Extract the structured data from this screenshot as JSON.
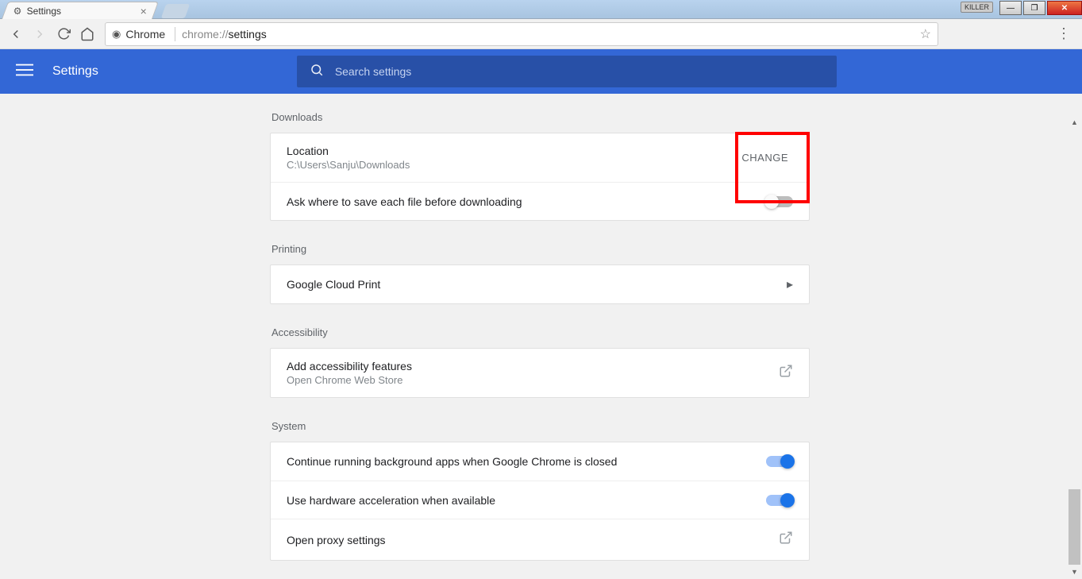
{
  "window": {
    "killer_label": "KILLER"
  },
  "tab": {
    "title": "Settings"
  },
  "omnibox": {
    "chip": "Chrome",
    "url_prefix": "chrome://",
    "url_bold": "settings"
  },
  "bluebar": {
    "title": "Settings"
  },
  "search": {
    "placeholder": "Search settings"
  },
  "sections": {
    "downloads": {
      "label": "Downloads",
      "location_label": "Location",
      "location_value": "C:\\Users\\Sanju\\Downloads",
      "change_btn": "CHANGE",
      "ask_label": "Ask where to save each file before downloading"
    },
    "printing": {
      "label": "Printing",
      "gcp": "Google Cloud Print"
    },
    "accessibility": {
      "label": "Accessibility",
      "add_t": "Add accessibility features",
      "add_s": "Open Chrome Web Store"
    },
    "system": {
      "label": "System",
      "bg": "Continue running background apps when Google Chrome is closed",
      "hw": "Use hardware acceleration when available",
      "proxy": "Open proxy settings"
    }
  }
}
